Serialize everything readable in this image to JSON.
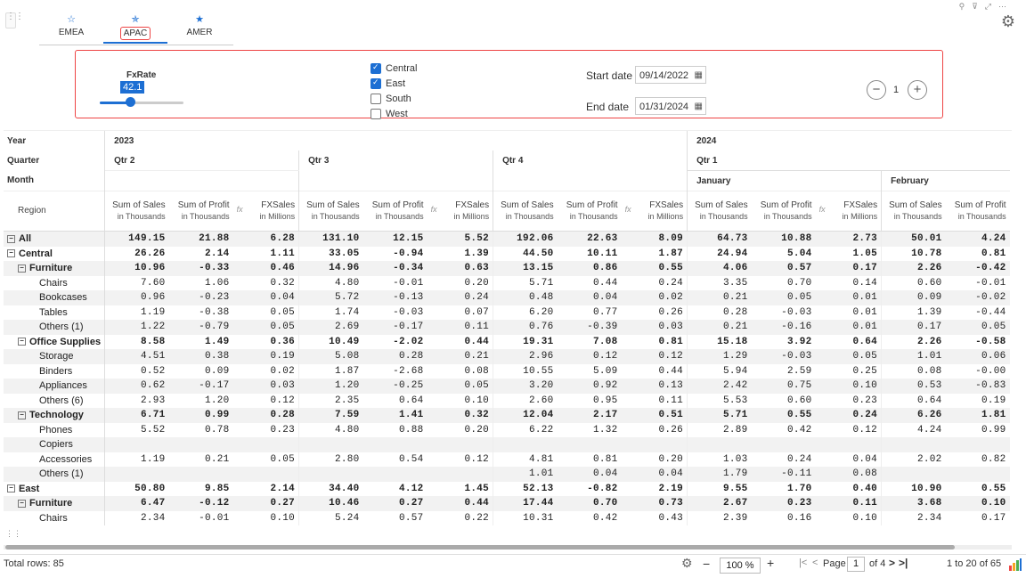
{
  "tabs": [
    {
      "label": "EMEA",
      "icon": "star-outline-icon"
    },
    {
      "label": "APAC",
      "icon": "star-half-icon",
      "active": true
    },
    {
      "label": "AMER",
      "icon": "star-filled-icon"
    }
  ],
  "filters": {
    "fxrate_label": "FxRate",
    "fxrate_value": "42.1",
    "fxrate_level": 0.36,
    "regions": [
      {
        "label": "Central",
        "checked": true
      },
      {
        "label": "East",
        "checked": true
      },
      {
        "label": "South",
        "checked": false
      },
      {
        "label": "West",
        "checked": false
      }
    ],
    "start_label": "Start date",
    "start_value": "09/14/2022",
    "end_label": "End date",
    "end_value": "01/31/2024",
    "stepper_value": "1",
    "minus": "−",
    "plus": "+"
  },
  "grid": {
    "row_headers": {
      "year": "Year",
      "quarter": "Quarter",
      "month": "Month",
      "region": "Region"
    },
    "years": [
      {
        "label": "2023"
      },
      {
        "label": "2024"
      }
    ],
    "quarters": [
      "Qtr 2",
      "Qtr 3",
      "Qtr 4",
      "Qtr 1"
    ],
    "months": [
      "January",
      "February"
    ],
    "measures": [
      {
        "name": "Sum of Sales",
        "unit": "in Thousands"
      },
      {
        "name": "Sum of Profit",
        "unit": "in Thousands"
      },
      {
        "name": "FXSales",
        "unit": "in Millions"
      }
    ],
    "rows": [
      {
        "label": "All",
        "level": 0,
        "exp": true,
        "bold": true,
        "vals": [
          "149.15",
          "21.88",
          "6.28",
          "131.10",
          "12.15",
          "5.52",
          "192.06",
          "22.63",
          "8.09",
          "64.73",
          "10.88",
          "2.73",
          "50.01",
          "4.24"
        ]
      },
      {
        "label": "Central",
        "level": 0,
        "exp": true,
        "bold": true,
        "vals": [
          "26.26",
          "2.14",
          "1.11",
          "33.05",
          "-0.94",
          "1.39",
          "44.50",
          "10.11",
          "1.87",
          "24.94",
          "5.04",
          "1.05",
          "10.78",
          "0.81"
        ]
      },
      {
        "label": "Furniture",
        "level": 1,
        "exp": true,
        "bold": true,
        "vals": [
          "10.96",
          "-0.33",
          "0.46",
          "14.96",
          "-0.34",
          "0.63",
          "13.15",
          "0.86",
          "0.55",
          "4.06",
          "0.57",
          "0.17",
          "2.26",
          "-0.42"
        ]
      },
      {
        "label": "Chairs",
        "level": 2,
        "vals": [
          "7.60",
          "1.06",
          "0.32",
          "4.80",
          "-0.01",
          "0.20",
          "5.71",
          "0.44",
          "0.24",
          "3.35",
          "0.70",
          "0.14",
          "0.60",
          "-0.01"
        ]
      },
      {
        "label": "Bookcases",
        "level": 2,
        "vals": [
          "0.96",
          "-0.23",
          "0.04",
          "5.72",
          "-0.13",
          "0.24",
          "0.48",
          "0.04",
          "0.02",
          "0.21",
          "0.05",
          "0.01",
          "0.09",
          "-0.02"
        ]
      },
      {
        "label": "Tables",
        "level": 2,
        "vals": [
          "1.19",
          "-0.38",
          "0.05",
          "1.74",
          "-0.03",
          "0.07",
          "6.20",
          "0.77",
          "0.26",
          "0.28",
          "-0.03",
          "0.01",
          "1.39",
          "-0.44"
        ]
      },
      {
        "label": "Others (1)",
        "level": 2,
        "vals": [
          "1.22",
          "-0.79",
          "0.05",
          "2.69",
          "-0.17",
          "0.11",
          "0.76",
          "-0.39",
          "0.03",
          "0.21",
          "-0.16",
          "0.01",
          "0.17",
          "0.05"
        ]
      },
      {
        "label": "Office Supplies",
        "level": 1,
        "exp": true,
        "bold": true,
        "vals": [
          "8.58",
          "1.49",
          "0.36",
          "10.49",
          "-2.02",
          "0.44",
          "19.31",
          "7.08",
          "0.81",
          "15.18",
          "3.92",
          "0.64",
          "2.26",
          "-0.58"
        ]
      },
      {
        "label": "Storage",
        "level": 2,
        "vals": [
          "4.51",
          "0.38",
          "0.19",
          "5.08",
          "0.28",
          "0.21",
          "2.96",
          "0.12",
          "0.12",
          "1.29",
          "-0.03",
          "0.05",
          "1.01",
          "0.06"
        ]
      },
      {
        "label": "Binders",
        "level": 2,
        "vals": [
          "0.52",
          "0.09",
          "0.02",
          "1.87",
          "-2.68",
          "0.08",
          "10.55",
          "5.09",
          "0.44",
          "5.94",
          "2.59",
          "0.25",
          "0.08",
          "-0.00"
        ]
      },
      {
        "label": "Appliances",
        "level": 2,
        "vals": [
          "0.62",
          "-0.17",
          "0.03",
          "1.20",
          "-0.25",
          "0.05",
          "3.20",
          "0.92",
          "0.13",
          "2.42",
          "0.75",
          "0.10",
          "0.53",
          "-0.83"
        ]
      },
      {
        "label": "Others (6)",
        "level": 2,
        "vals": [
          "2.93",
          "1.20",
          "0.12",
          "2.35",
          "0.64",
          "0.10",
          "2.60",
          "0.95",
          "0.11",
          "5.53",
          "0.60",
          "0.23",
          "0.64",
          "0.19"
        ]
      },
      {
        "label": "Technology",
        "level": 1,
        "exp": true,
        "bold": true,
        "vals": [
          "6.71",
          "0.99",
          "0.28",
          "7.59",
          "1.41",
          "0.32",
          "12.04",
          "2.17",
          "0.51",
          "5.71",
          "0.55",
          "0.24",
          "6.26",
          "1.81"
        ]
      },
      {
        "label": "Phones",
        "level": 2,
        "vals": [
          "5.52",
          "0.78",
          "0.23",
          "4.80",
          "0.88",
          "0.20",
          "6.22",
          "1.32",
          "0.26",
          "2.89",
          "0.42",
          "0.12",
          "4.24",
          "0.99"
        ]
      },
      {
        "label": "Copiers",
        "level": 2,
        "vals": [
          "",
          "",
          "",
          "",
          "",
          "",
          "",
          "",
          "",
          "",
          "",
          "",
          "",
          ""
        ]
      },
      {
        "label": "Accessories",
        "level": 2,
        "vals": [
          "1.19",
          "0.21",
          "0.05",
          "2.80",
          "0.54",
          "0.12",
          "4.81",
          "0.81",
          "0.20",
          "1.03",
          "0.24",
          "0.04",
          "2.02",
          "0.82"
        ]
      },
      {
        "label": "Others (1)",
        "level": 2,
        "vals": [
          "",
          "",
          "",
          "",
          "",
          "",
          "1.01",
          "0.04",
          "0.04",
          "1.79",
          "-0.11",
          "0.08",
          "",
          ""
        ]
      },
      {
        "label": "East",
        "level": 0,
        "exp": true,
        "bold": true,
        "vals": [
          "50.80",
          "9.85",
          "2.14",
          "34.40",
          "4.12",
          "1.45",
          "52.13",
          "-0.82",
          "2.19",
          "9.55",
          "1.70",
          "0.40",
          "10.90",
          "0.55"
        ]
      },
      {
        "label": "Furniture",
        "level": 1,
        "exp": true,
        "bold": true,
        "vals": [
          "6.47",
          "-0.12",
          "0.27",
          "10.46",
          "0.27",
          "0.44",
          "17.44",
          "0.70",
          "0.73",
          "2.67",
          "0.23",
          "0.11",
          "3.68",
          "0.10"
        ]
      },
      {
        "label": "Chairs",
        "level": 2,
        "vals": [
          "2.34",
          "-0.01",
          "0.10",
          "5.24",
          "0.57",
          "0.22",
          "10.31",
          "0.42",
          "0.43",
          "2.39",
          "0.16",
          "0.10",
          "2.34",
          "0.17"
        ]
      }
    ]
  },
  "footer": {
    "total_rows": "Total rows: 85",
    "zoom": "100 %",
    "page_label": "Page",
    "page_value": "1",
    "page_of": "of 4",
    "range": "1 to 20 of 65"
  }
}
